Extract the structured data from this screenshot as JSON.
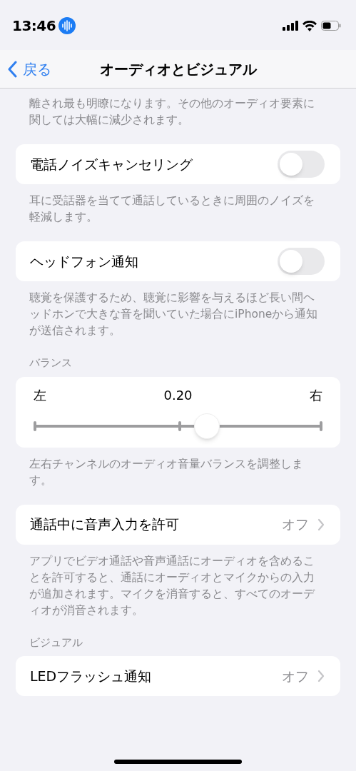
{
  "status_bar": {
    "time": "13:46"
  },
  "nav": {
    "back": "戻る",
    "title": "オーディオとビジュアル"
  },
  "sections": [
    {
      "kind": "note",
      "footer": "離され最も明瞭になります。その他のオーディオ要素に関しては大幅に減少されます。"
    },
    {
      "kind": "toggle",
      "label": "電話ノイズキャンセリング",
      "on": false,
      "footer": "耳に受話器を当てて通話しているときに周囲のノイズを軽減します。"
    },
    {
      "kind": "toggle",
      "label": "ヘッドフォン通知",
      "on": false,
      "footer": "聴覚を保護するため、聴覚に影響を与えるほど長い間ヘッドホンで大きな音を聞いていた場合にiPhoneから通知が送信されます。"
    },
    {
      "kind": "slider",
      "header": "バランス",
      "left": "左",
      "value": "0.20",
      "right": "右",
      "level": 0.6,
      "footer": "左右チャンネルのオーディオ音量バランスを調整します。"
    },
    {
      "kind": "link",
      "label": "通話中に音声入力を許可",
      "value": "オフ",
      "footer": "アプリでビデオ通話や音声通話にオーディオを含めることを許可すると、通話にオーディオとマイクからの入力が追加されます。マイクを消音すると、すべてのオーディオが消音されます。"
    },
    {
      "kind": "link",
      "header": "ビジュアル",
      "label": "LEDフラッシュ通知",
      "value": "オフ"
    }
  ]
}
